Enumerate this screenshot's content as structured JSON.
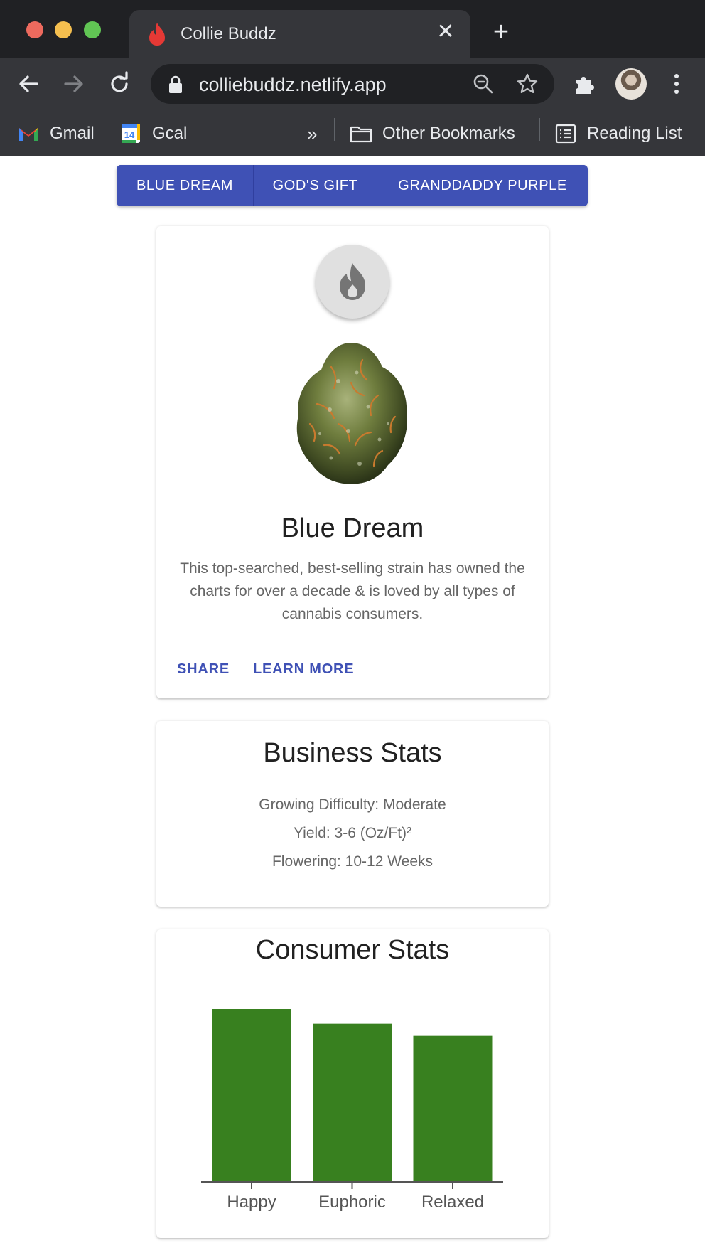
{
  "browser": {
    "tab_title": "Collie Buddz",
    "url": "colliebuddz.netlify.app",
    "bookmarks": {
      "gmail": "Gmail",
      "gcal": "Gcal",
      "gcal_badge": "14",
      "more": "»",
      "other": "Other Bookmarks",
      "reading": "Reading List"
    }
  },
  "strain_tabs": [
    "BLUE DREAM",
    "GOD'S GIFT",
    "GRANDDADDY PURPLE"
  ],
  "strain_card": {
    "title": "Blue Dream",
    "description": "This top-searched, best-selling strain has owned the charts for over a decade & is loved by all types of cannabis consumers.",
    "share_label": "SHARE",
    "learn_more_label": "LEARN MORE"
  },
  "business_stats": {
    "title": "Business Stats",
    "difficulty": "Growing Difficulty: Moderate",
    "yield": "Yield: 3-6 (Oz/Ft)²",
    "flowering": "Flowering: 10-12 Weeks"
  },
  "consumer_stats": {
    "title": "Consumer Stats"
  },
  "colors": {
    "primary": "#3f51b5",
    "bar": "#38801f",
    "favicon": "#e53935"
  },
  "chart_data": {
    "type": "bar",
    "categories": [
      "Happy",
      "Euphoric",
      "Relaxed"
    ],
    "values": [
      100,
      91.5,
      84.5
    ],
    "ylim": [
      0,
      100
    ],
    "grid": false,
    "legend": "none"
  }
}
